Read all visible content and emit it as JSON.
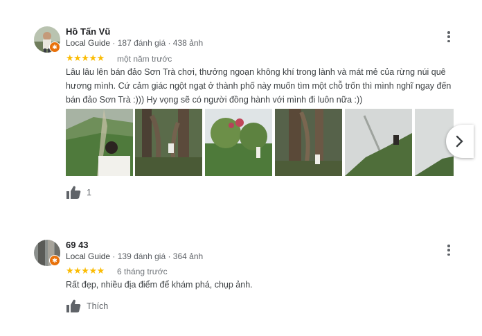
{
  "reviews": [
    {
      "name": "Hồ Tấn Vũ",
      "local_guide": "Local Guide",
      "stats": "· 187 đánh giá · 438 ảnh",
      "stars": "★★★★★",
      "rating": 5,
      "time": "một năm trước",
      "text": "Lâu lâu lên bán đảo Sơn Trà chơi, thưởng ngoạn không khí trong lành và mát mẻ của rừng núi quê hương mình. Cứ cảm giác ngột ngạt ở thành phố này muốn tìm một chỗ trốn thì mình nghĩ ngay đến bán đảo Sơn Trà :))) Hy vọng sẽ có người đồng hành với mình đi luôn nữa :))",
      "likes": "1",
      "photo_count": 6
    },
    {
      "name": "69 43",
      "local_guide": "Local Guide",
      "stats": "· 139 đánh giá · 364 ảnh",
      "stars": "★★★★★",
      "rating": 5,
      "time": "6 tháng trước",
      "text": "Rất đẹp, nhiều địa điểm để khám phá, chụp ảnh.",
      "likes": "Thích"
    }
  ],
  "icons": {
    "more": "more-vert-icon",
    "like": "thumb-up-icon",
    "next": "chevron-right-icon",
    "badge": "local-guide-badge-icon"
  },
  "colors": {
    "star": "#fbbc04",
    "badge": "#e8710a",
    "text": "#3c4043",
    "secondary": "#5f6368"
  }
}
